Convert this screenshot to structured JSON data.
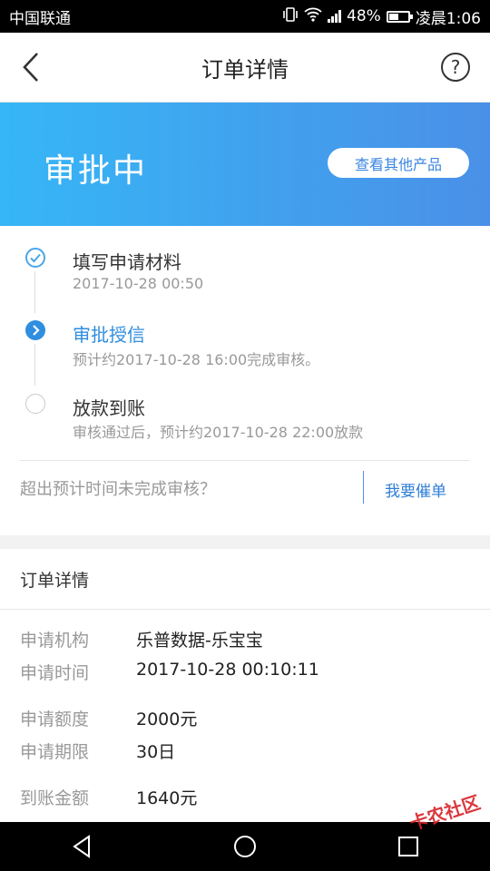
{
  "status_bar": {
    "carrier": "中国联通",
    "battery": "48%",
    "time": "凌晨1:06"
  },
  "nav": {
    "title": "订单详情",
    "help_icon": "?"
  },
  "banner": {
    "status": "审批中",
    "button_label": "查看其他产品"
  },
  "steps": [
    {
      "title": "填写申请材料",
      "sub": "2017-10-28 00:50",
      "state": "done"
    },
    {
      "title": "审批授信",
      "sub": "预计约2017-10-28 16:00完成审核。",
      "state": "active"
    },
    {
      "title": "放款到账",
      "sub": "审核通过后，预计约2017-10-28 22:00放款",
      "state": "pending"
    }
  ],
  "urge": {
    "question": "超出预计时间未完成审核？",
    "button_label": "我要催单"
  },
  "detail": {
    "header": "订单详情",
    "rows": [
      {
        "label": "申请机构",
        "value": "乐普数据-乐宝宝"
      },
      {
        "label": "申请时间",
        "value": "2017-10-28 00:10:11"
      },
      {
        "label": "申请额度",
        "value": "2000元"
      },
      {
        "label": "申请期限",
        "value": "30日"
      },
      {
        "label": "到账金额",
        "value": "1640元"
      }
    ]
  },
  "watermark": "卡农社区",
  "colors": {
    "accent": "#2f8ee0",
    "banner_start": "#36b6f6",
    "banner_end": "#4a90e8"
  }
}
